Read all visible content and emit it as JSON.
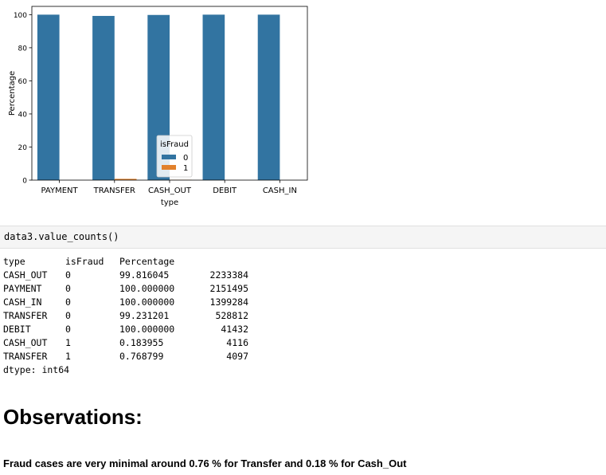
{
  "chart_data": {
    "type": "bar",
    "xlabel": "type",
    "ylabel": "Percentage",
    "categories": [
      "PAYMENT",
      "TRANSFER",
      "CASH_OUT",
      "DEBIT",
      "CASH_IN"
    ],
    "yticks": [
      0,
      20,
      40,
      60,
      80,
      100
    ],
    "ylim": [
      0,
      105
    ],
    "series": [
      {
        "name": "0",
        "color": "#3274a1",
        "values": [
          100.0,
          99.231201,
          99.816045,
          100.0,
          100.0
        ]
      },
      {
        "name": "1",
        "color": "#e1812c",
        "values": [
          0,
          0.768799,
          0.183955,
          0,
          0
        ]
      }
    ],
    "legend": {
      "title": "isFraud",
      "placement": "lower-center"
    },
    "grid": false
  },
  "code_cell": {
    "source": "data3.value_counts()"
  },
  "output": {
    "header": {
      "type": "type",
      "isFraud": "isFraud",
      "percentage": "Percentage"
    },
    "rows": [
      {
        "type": "CASH_OUT",
        "isFraud": "0",
        "percentage": "99.816045",
        "count": "2233384"
      },
      {
        "type": "PAYMENT",
        "isFraud": "0",
        "percentage": "100.000000",
        "count": "2151495"
      },
      {
        "type": "CASH_IN",
        "isFraud": "0",
        "percentage": "100.000000",
        "count": "1399284"
      },
      {
        "type": "TRANSFER",
        "isFraud": "0",
        "percentage": "99.231201",
        "count": "528812"
      },
      {
        "type": "DEBIT",
        "isFraud": "0",
        "percentage": "100.000000",
        "count": "41432"
      },
      {
        "type": "CASH_OUT",
        "isFraud": "1",
        "percentage": "0.183955",
        "count": "4116"
      },
      {
        "type": "TRANSFER",
        "isFraud": "1",
        "percentage": "0.768799",
        "count": "4097"
      }
    ],
    "dtype": "dtype: int64"
  },
  "markdown": {
    "heading": "Observations:",
    "text": "Fraud cases are very minimal around 0.76 % for Transfer and 0.18 % for Cash_Out"
  }
}
